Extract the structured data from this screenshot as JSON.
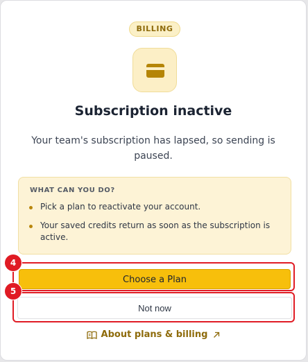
{
  "badge": "BILLING",
  "icon": "credit-card-icon",
  "title": "Subscription inactive",
  "description": "Your team's subscription has lapsed, so sending is paused.",
  "info": {
    "heading": "WHAT CAN YOU DO?",
    "items": [
      "Pick a plan to reactivate your account.",
      "Your saved credits return as soon as the subscription is active."
    ]
  },
  "buttons": {
    "primary": "Choose a Plan",
    "secondary": "Not now"
  },
  "annotations": {
    "primary_marker": "4",
    "secondary_marker": "5"
  },
  "link": {
    "label": "About plans & billing",
    "icon": "book-icon",
    "external_icon": "external-arrow-icon"
  },
  "colors": {
    "accent": "#f7bf0b",
    "accent_text": "#8e6b0b",
    "highlight": "#e01b24"
  }
}
